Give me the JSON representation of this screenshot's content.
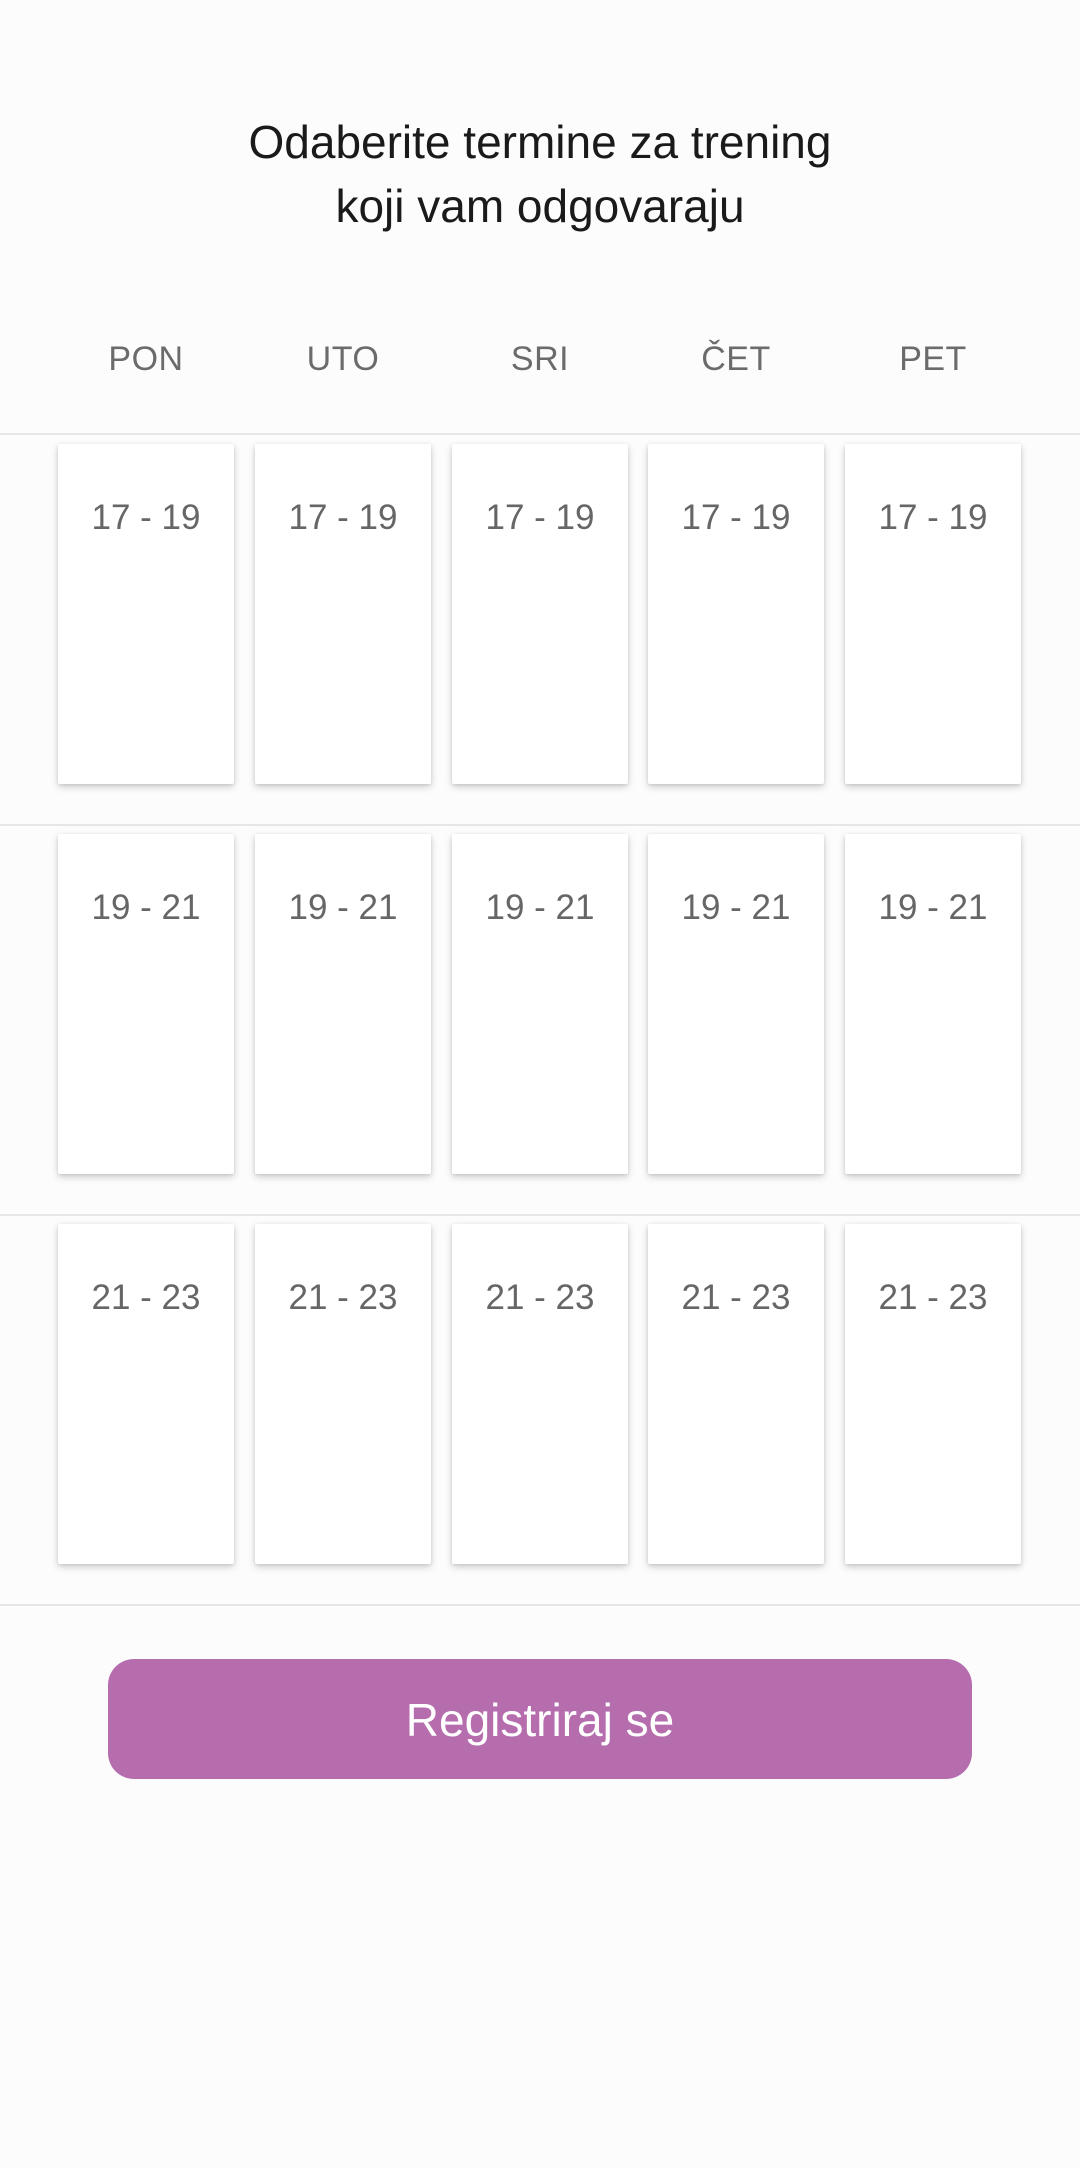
{
  "header": {
    "title_line1": "Odaberite termine za trening",
    "title_line2": "koji vam odgovaraju"
  },
  "days": [
    "PON",
    "UTO",
    "SRI",
    "ČET",
    "PET"
  ],
  "rows": [
    {
      "label": "17 - 19"
    },
    {
      "label": "19 - 21"
    },
    {
      "label": "21 - 23"
    }
  ],
  "register_button": {
    "label": "Registriraj se"
  },
  "colors": {
    "accent": "#b56dae",
    "background": "#fdfcfd",
    "card": "#ffffff",
    "text_muted": "#666666"
  }
}
